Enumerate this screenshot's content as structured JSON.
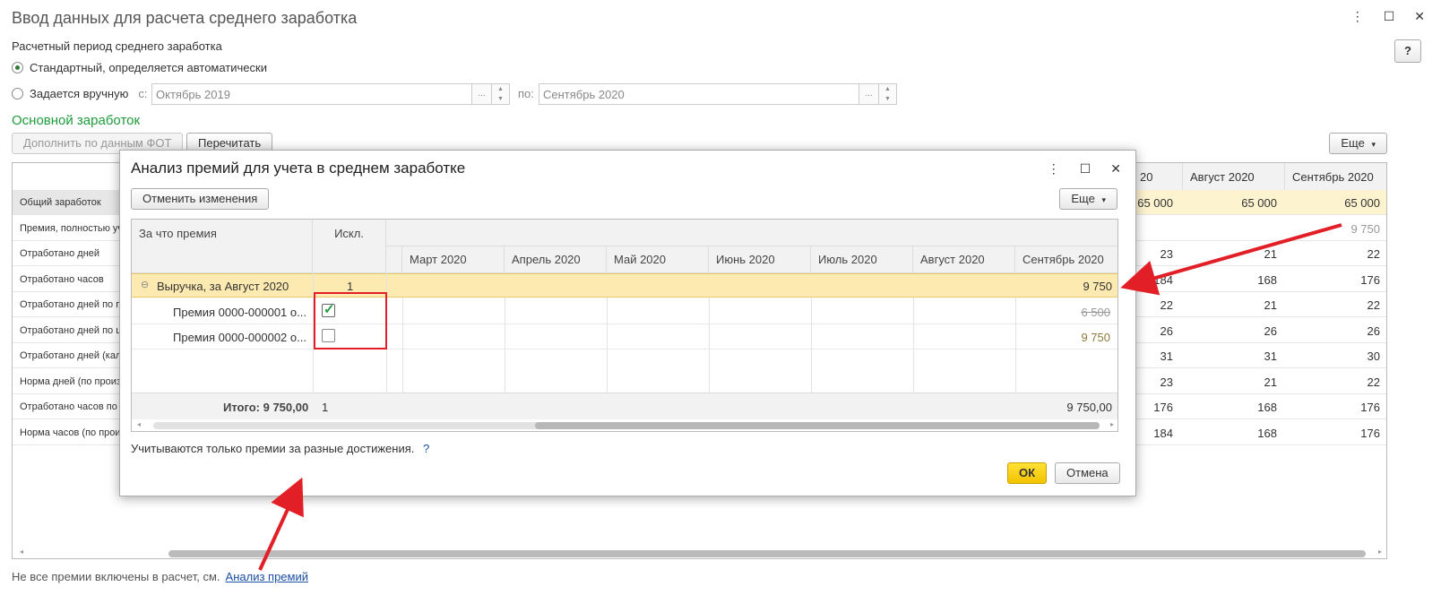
{
  "window": {
    "title": "Ввод данных для расчета среднего заработка",
    "help_label": "?"
  },
  "period": {
    "label": "Расчетный период среднего заработка",
    "option_auto": "Стандартный, определяется автоматически",
    "option_manual": "Задается вручную",
    "from_label": "с:",
    "from_value": "Октябрь 2019",
    "to_label": "по:",
    "to_value": "Сентябрь 2020",
    "selected": "auto"
  },
  "main_section": {
    "title": "Основной заработок",
    "fill_button": "Дополнить по данным ФОТ",
    "recalc_button": "Перечитать",
    "more_button": "Еще"
  },
  "bg_table": {
    "headers": [
      "Август 2020",
      "Сентябрь 2020"
    ],
    "partial_header": "20",
    "rows": [
      {
        "label": "Общий заработок",
        "c1": "65 000",
        "c2": "65 000",
        "c3": "65 000"
      },
      {
        "label": "Премия, полностью уч",
        "c1": "",
        "c2": "",
        "c3": "9 750"
      },
      {
        "label": "Отработано дней",
        "c1": "23",
        "c2": "21",
        "c3": "22"
      },
      {
        "label": "Отработано часов",
        "c1": "184",
        "c2": "168",
        "c3": "176"
      },
      {
        "label": "Отработано дней по пя",
        "c1": "22",
        "c2": "21",
        "c3": "22"
      },
      {
        "label": "Отработано дней по ше",
        "c1": "26",
        "c2": "26",
        "c3": "26"
      },
      {
        "label": "Отработано дней (кале",
        "c1": "31",
        "c2": "31",
        "c3": "30"
      },
      {
        "label": "Норма дней (по произ",
        "c1": "23",
        "c2": "21",
        "c3": "22"
      },
      {
        "label": "Отработано часов по п",
        "c1": "176",
        "c2": "168",
        "c3": "176"
      },
      {
        "label": "Норма часов (по произ",
        "c1": "184",
        "c2": "168",
        "c3": "176"
      }
    ]
  },
  "footer": {
    "note": "Не все премии включены в расчет, см.",
    "link": "Анализ премий"
  },
  "dialog": {
    "title": "Анализ премий для учета в среднем заработке",
    "cancel_changes": "Отменить изменения",
    "more_button": "Еще",
    "col_reason": "За что премия",
    "col_excl": "Искл.",
    "months": [
      "Март 2020",
      "Апрель 2020",
      "Май 2020",
      "Июнь 2020",
      "Июль 2020",
      "Август 2020",
      "Сентябрь 2020"
    ],
    "group_row": {
      "label": "Выручка, за Август 2020",
      "excl": "1",
      "sep": "9 750"
    },
    "items": [
      {
        "label": "Премия 0000-000001 о...",
        "checked": true,
        "value": "6 500"
      },
      {
        "label": "Премия 0000-000002 о...",
        "checked": false,
        "value": "9 750"
      }
    ],
    "total_label": "Итого: 9 750,00",
    "total_excl": "1",
    "total_value": "9 750,00",
    "note": "Учитываются только премии за разные достижения.",
    "note_help": "?",
    "ok_button": "ОК",
    "cancel_button": "Отмена"
  }
}
